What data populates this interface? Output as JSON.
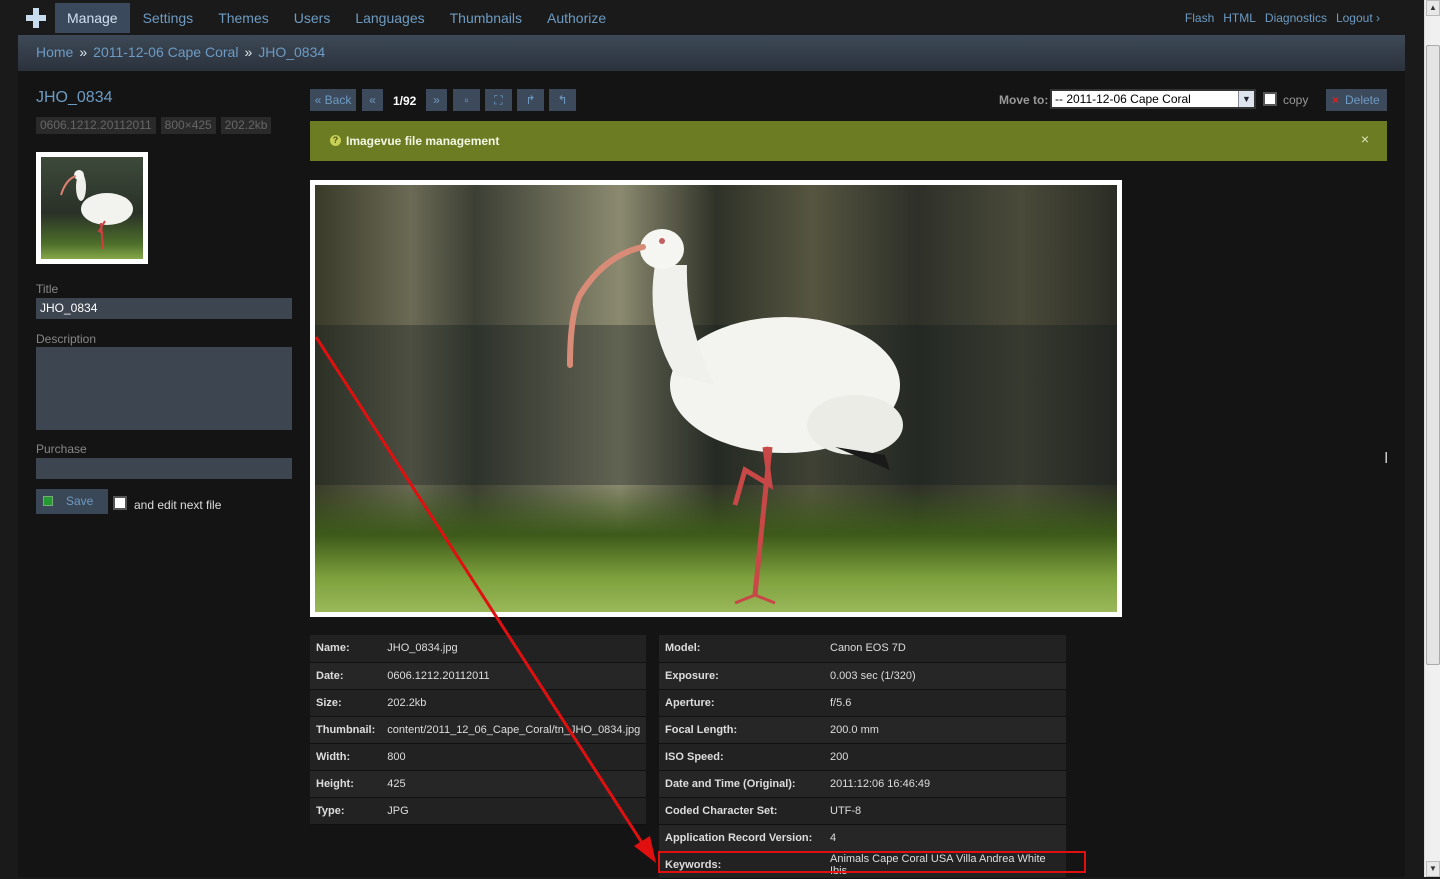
{
  "nav": {
    "items": [
      "Manage",
      "Settings",
      "Themes",
      "Users",
      "Languages",
      "Thumbnails",
      "Authorize"
    ],
    "links": [
      "Flash",
      "HTML",
      "Diagnostics",
      "Logout ›"
    ]
  },
  "breadcrumb": [
    "Home",
    "2011-12-06 Cape Coral",
    "JHO_0834"
  ],
  "sidebar": {
    "file_title": "JHO_0834",
    "tags": [
      "0606.1212.20112011",
      "800×425",
      "202.2kb"
    ],
    "title_label": "Title",
    "title_value": "JHO_0834",
    "description_label": "Description",
    "description_value": "",
    "purchase_label": "Purchase",
    "purchase_value": "",
    "save_label": "Save",
    "edit_next_label": "and edit next file"
  },
  "toolbar": {
    "back_label": "« Back",
    "prev_label": "«",
    "counter": "1/92",
    "next_label": "»",
    "move_to_label": "Move to:",
    "move_to_value": "-- 2011-12-06 Cape Coral",
    "copy_label": "copy",
    "delete_label": "Delete"
  },
  "banner": {
    "message": "Imagevue file management",
    "close": "×"
  },
  "file_info": [
    {
      "k": "Name:",
      "v": "JHO_0834.jpg"
    },
    {
      "k": "Date:",
      "v": "0606.1212.20112011"
    },
    {
      "k": "Size:",
      "v": "202.2kb"
    },
    {
      "k": "Thumbnail:",
      "v": "content/2011_12_06_Cape_Coral/tn_JHO_0834.jpg"
    },
    {
      "k": "Width:",
      "v": "800"
    },
    {
      "k": "Height:",
      "v": "425"
    },
    {
      "k": "Type:",
      "v": "JPG"
    }
  ],
  "exif": [
    {
      "k": "Model:",
      "v": "Canon EOS 7D"
    },
    {
      "k": "Exposure:",
      "v": "0.003 sec (1/320)"
    },
    {
      "k": "Aperture:",
      "v": "f/5.6"
    },
    {
      "k": "Focal Length:",
      "v": "200.0 mm"
    },
    {
      "k": "ISO Speed:",
      "v": "200"
    },
    {
      "k": "Date and Time (Original):",
      "v": "2011:12:06 16:46:49"
    },
    {
      "k": "Coded Character Set:",
      "v": "UTF-8"
    },
    {
      "k": "Application Record Version:",
      "v": "4"
    },
    {
      "k": "Keywords:",
      "v": "Animals Cape Coral USA Villa Andrea White Ibis"
    }
  ],
  "colors": {
    "accent": "#6d9bc3",
    "banner": "#6c7c22",
    "highlight": "#e01010"
  }
}
